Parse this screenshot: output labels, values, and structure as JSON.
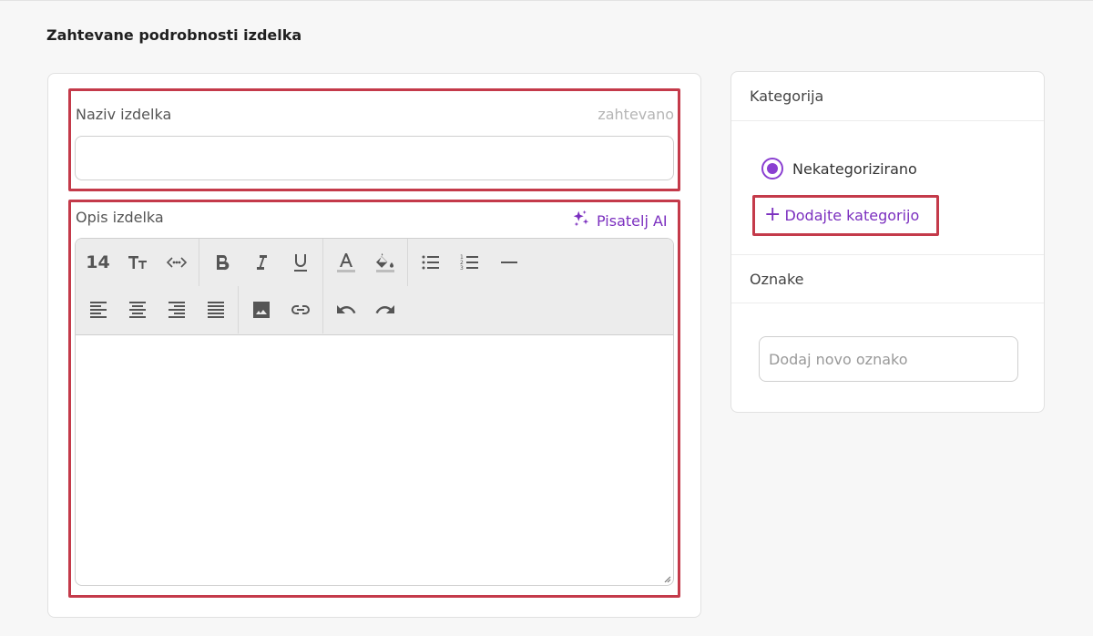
{
  "section": {
    "title": "Zahtevane podrobnosti izdelka"
  },
  "product": {
    "name_label": "Naziv izdelka",
    "required_label": "zahtevano",
    "name_value": "",
    "description_label": "Opis izdelka",
    "ai_writer_label": "Pisatelj AI",
    "font_size_value": "14"
  },
  "toolbar_icons": [
    "font-size",
    "text-size-icon",
    "code-icon",
    "bold-icon",
    "italic-icon",
    "underline-icon",
    "text-color-icon",
    "fill-color-icon",
    "bullet-list-icon",
    "numbered-list-icon",
    "horizontal-rule-icon",
    "align-left-icon",
    "align-center-icon",
    "align-right-icon",
    "justify-icon",
    "image-icon",
    "link-icon",
    "undo-icon",
    "redo-icon"
  ],
  "category": {
    "header": "Kategorija",
    "selected_option": "Nekategorizirano",
    "add_label": "Dodajte kategorijo"
  },
  "tags": {
    "header": "Oznake",
    "placeholder": "Dodaj novo oznako"
  },
  "colors": {
    "accent": "#7b2fbf",
    "highlight": "#c43a4a"
  }
}
